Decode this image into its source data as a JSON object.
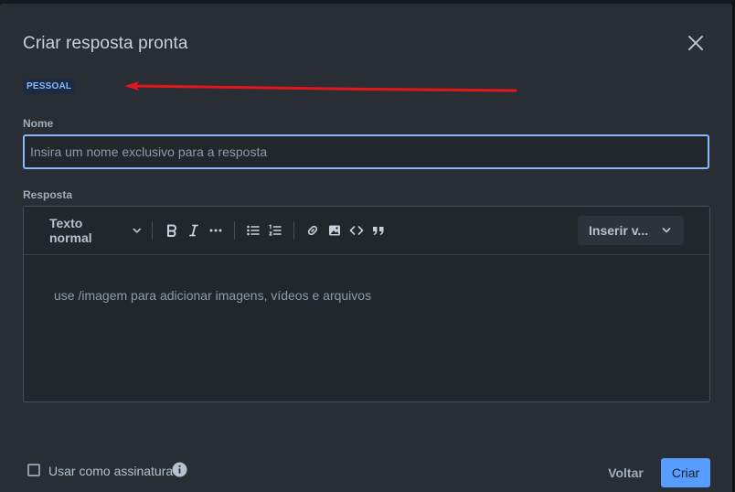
{
  "modal": {
    "title": "Criar resposta pronta",
    "badge": "PESSOAL",
    "accent_color": "#579dff",
    "annotation_color": "#e2161b"
  },
  "form": {
    "name_label": "Nome",
    "name_placeholder": "Insira um nome exclusivo para a resposta",
    "response_label": "Resposta",
    "editor_placeholder": "use /imagem para adicionar imagens, vídeos e arquivos"
  },
  "toolbar": {
    "text_style": "Texto normal",
    "insert_label": "Inserir v...",
    "icons": [
      "chevron-down-icon",
      "bold-icon",
      "italic-icon",
      "more-icon",
      "bullet-list-icon",
      "numbered-list-icon",
      "link-icon",
      "image-icon",
      "code-icon",
      "quote-icon"
    ]
  },
  "footer": {
    "signature_label": "Usar como assinatura",
    "signature_checked": false,
    "back_label": "Voltar",
    "create_label": "Criar"
  }
}
